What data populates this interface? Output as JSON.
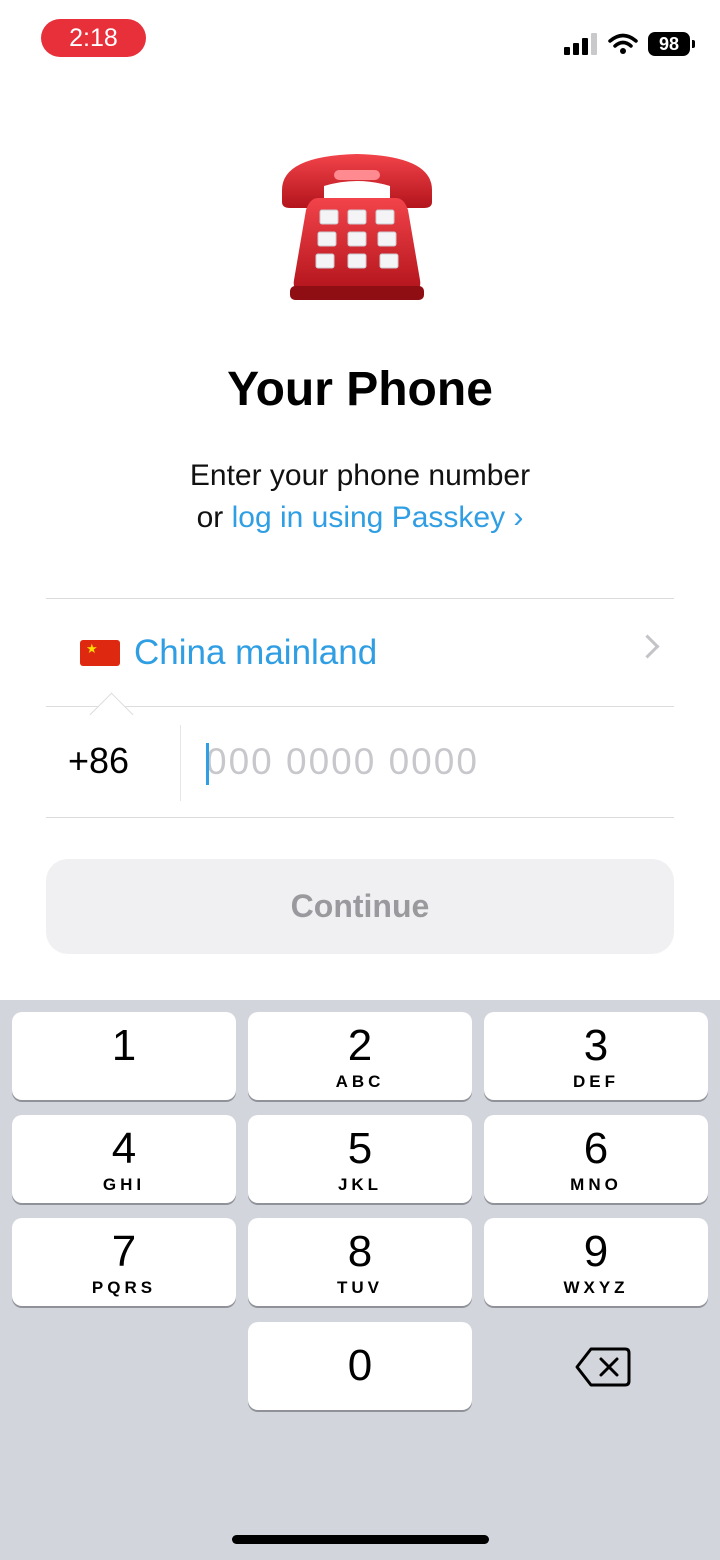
{
  "status_bar": {
    "time": "2:18",
    "battery": "98"
  },
  "header": {
    "title": "Your Phone",
    "subtitle_line1": "Enter your phone number",
    "subtitle_prefix": "or ",
    "passkey_link": "log in using Passkey ›"
  },
  "form": {
    "country_name": "China mainland",
    "country_code": "+86",
    "phone_value": "",
    "phone_placeholder": "000 0000 0000",
    "continue_label": "Continue"
  },
  "keyboard": {
    "keys": [
      {
        "digit": "1",
        "letters": ""
      },
      {
        "digit": "2",
        "letters": "ABC"
      },
      {
        "digit": "3",
        "letters": "DEF"
      },
      {
        "digit": "4",
        "letters": "GHI"
      },
      {
        "digit": "5",
        "letters": "JKL"
      },
      {
        "digit": "6",
        "letters": "MNO"
      },
      {
        "digit": "7",
        "letters": "PQRS"
      },
      {
        "digit": "8",
        "letters": "TUV"
      },
      {
        "digit": "9",
        "letters": "WXYZ"
      },
      {
        "digit": "0",
        "letters": ""
      }
    ]
  },
  "colors": {
    "accent": "#2f9ee3",
    "time_pill": "#e8303a",
    "continue_disabled_bg": "#f0f0f2",
    "keyboard_bg": "#d2d5dc"
  },
  "icons": [
    "phone-emoji-icon",
    "signal-icon",
    "wifi-icon",
    "battery-icon",
    "flag-china-icon",
    "chevron-right-icon",
    "backspace-icon"
  ]
}
